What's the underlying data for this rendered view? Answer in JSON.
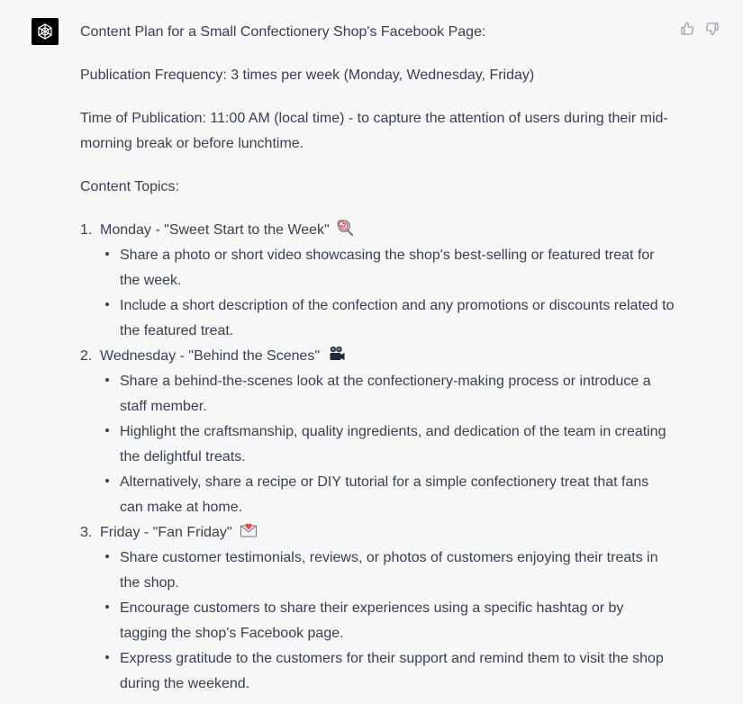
{
  "message": {
    "intro": "Content Plan for a Small Confectionery Shop's Facebook Page:",
    "frequency": "Publication Frequency: 3 times per week (Monday, Wednesday, Friday)",
    "time": "Time of Publication: 11:00 AM (local time) - to capture the attention of users during their mid-morning break or before lunchtime.",
    "topics_heading": "Content Topics:",
    "topics": [
      {
        "number": "1.",
        "title": "Monday - \"Sweet Start to the Week\"",
        "emoji": "lollipop-icon",
        "bullets": [
          "Share a photo or short video showcasing the shop's best-selling or featured treat for the week.",
          "Include a short description of the confection and any promotions or discounts related to the featured treat."
        ]
      },
      {
        "number": "2.",
        "title": "Wednesday - \"Behind the Scenes\"",
        "emoji": "film-camera-icon",
        "bullets": [
          "Share a behind-the-scenes look at the confectionery-making process or introduce a staff member.",
          "Highlight the craftsmanship, quality ingredients, and dedication of the team in creating the delightful treats.",
          "Alternatively, share a recipe or DIY tutorial for a simple confectionery treat that fans can make at home."
        ]
      },
      {
        "number": "3.",
        "title": "Friday - \"Fan Friday\"",
        "emoji": "love-letter-icon",
        "bullets": [
          "Share customer testimonials, reviews, or photos of customers enjoying their treats in the shop.",
          "Encourage customers to share their experiences using a specific hashtag or by tagging the shop's Facebook page.",
          "Express gratitude to the customers for their support and remind them to visit the shop during the weekend."
        ]
      }
    ]
  },
  "icons": {
    "avatar": "openai-logo-icon",
    "like": "thumbs-up-icon",
    "dislike": "thumbs-down-icon"
  },
  "colors": {
    "background": "#f7f7f8",
    "text": "#374151",
    "avatar_bg": "#000000"
  }
}
